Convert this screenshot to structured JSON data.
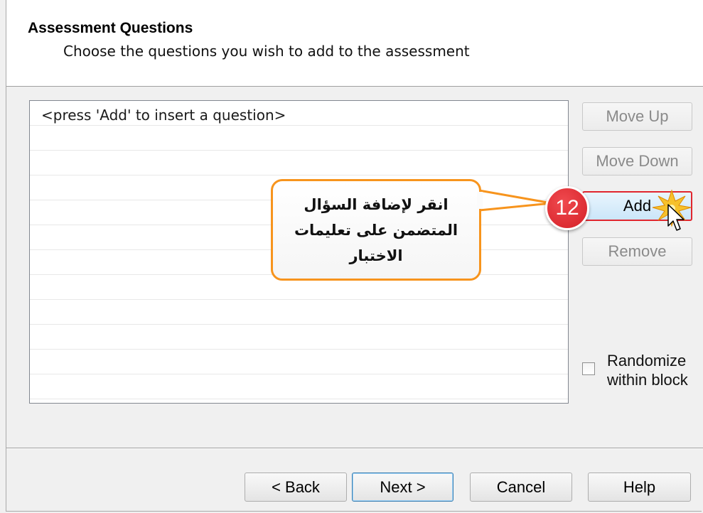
{
  "header": {
    "title": "Assessment Questions",
    "subtitle": "Choose the questions you wish to add to the assessment"
  },
  "question_list": {
    "placeholder_row": "<press 'Add' to insert a question>"
  },
  "side_buttons": {
    "move_up": "Move Up",
    "move_down": "Move Down",
    "add": "Add",
    "remove": "Remove"
  },
  "randomize": {
    "line1": "Randomize",
    "line2": "within block"
  },
  "footer_buttons": {
    "back": "< Back",
    "next": "Next >",
    "cancel": "Cancel",
    "help": "Help"
  },
  "annotation": {
    "step_number": "12",
    "callout_text": "انقر لإضافة السؤال\nالمتضمن على تعليمات\nالاختبار"
  },
  "colors": {
    "callout_border": "#f7941d",
    "step_badge": "#d41f26",
    "highlight_border": "#e0262e"
  },
  "icons": {
    "cursor": "arrow-cursor-icon",
    "click": "click-burst-icon"
  }
}
